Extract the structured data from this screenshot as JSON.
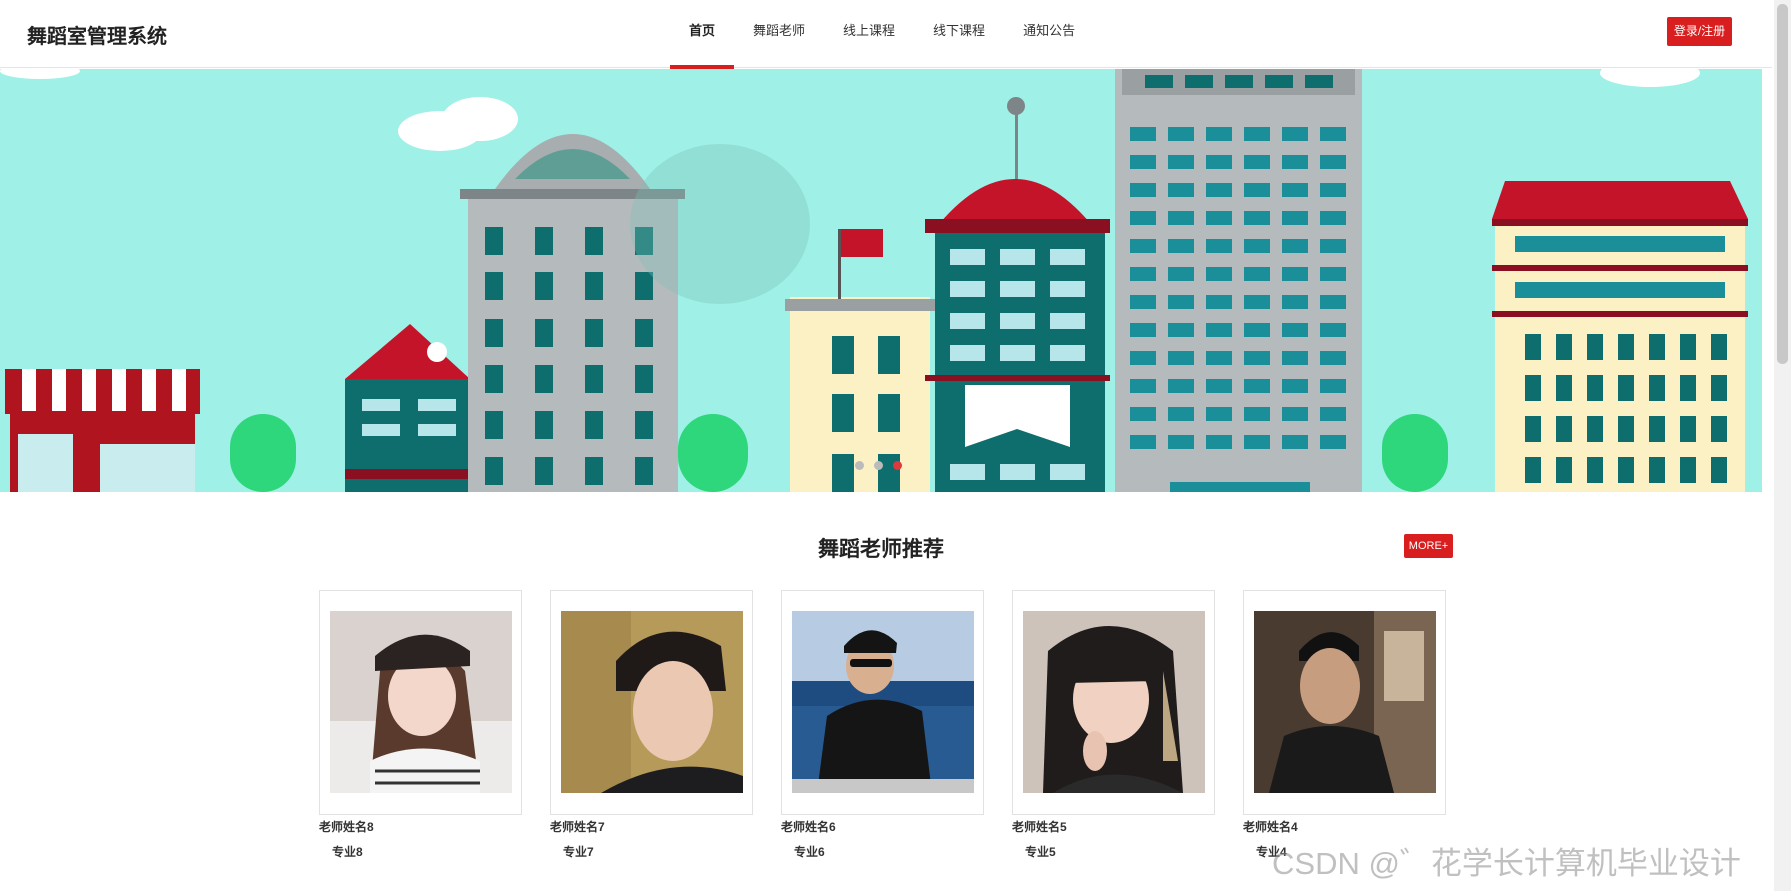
{
  "header": {
    "brand": "舞蹈室管理系统",
    "nav": [
      "首页",
      "舞蹈老师",
      "线上课程",
      "线下课程",
      "通知公告"
    ],
    "active_nav": "首页",
    "login_label": "登录/注册"
  },
  "banner": {
    "slides_count": 3,
    "active_slide": 3
  },
  "section": {
    "title": "舞蹈老师推荐",
    "more_label": "MORE+"
  },
  "teachers": [
    {
      "name": "老师姓名8",
      "major": "专业8"
    },
    {
      "name": "老师姓名7",
      "major": "专业7"
    },
    {
      "name": "老师姓名6",
      "major": "专业6"
    },
    {
      "name": "老师姓名5",
      "major": "专业5"
    },
    {
      "name": "老师姓名4",
      "major": "专业4"
    }
  ],
  "watermark": "CSDN @゛花学长计算机毕业设计",
  "colors": {
    "accent": "#d81e1e",
    "banner_sky": "#9ff0e6"
  }
}
